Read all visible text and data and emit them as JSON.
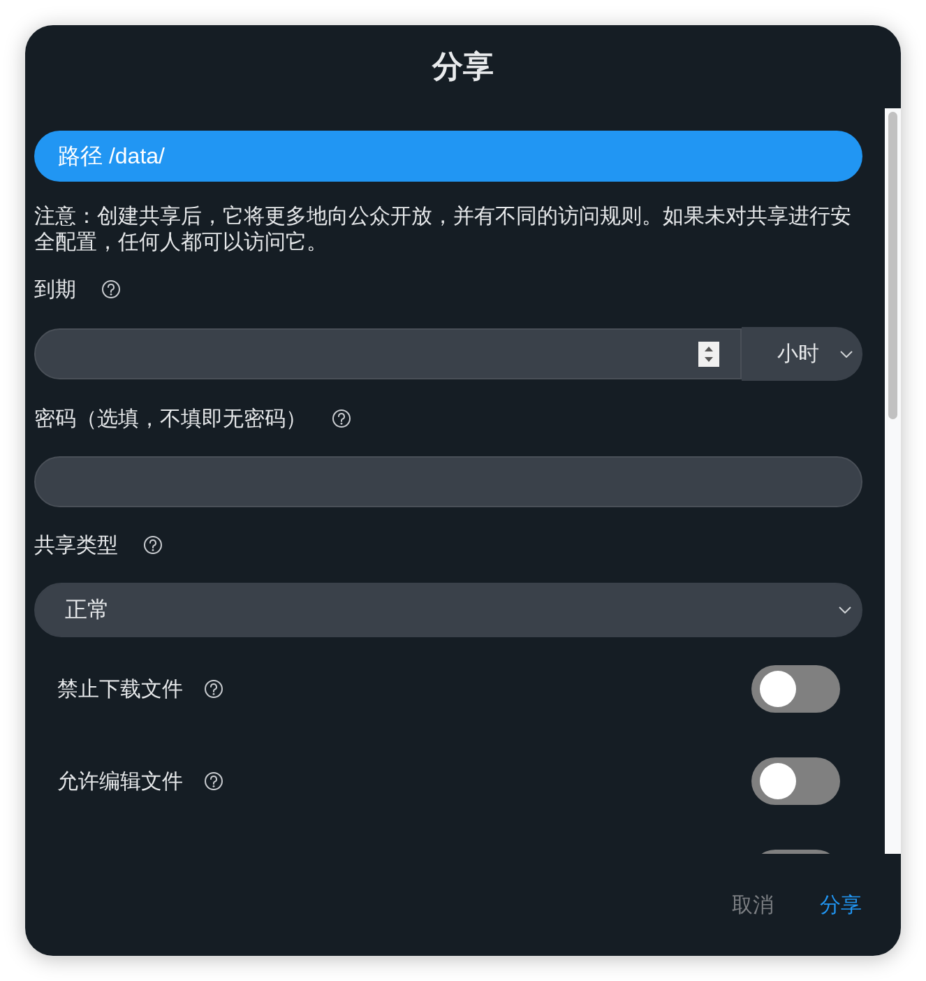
{
  "dialog": {
    "title": "分享"
  },
  "path": {
    "label": "路径",
    "value": "/data/"
  },
  "notice": "注意：创建共享后，它将更多地向公众开放，并有不同的访问规则。如果未对共享进行安全配置，任何人都可以访问它。",
  "expiry": {
    "label": "到期",
    "unit": "小时"
  },
  "password": {
    "label": "密码（选填，不填即无密码）"
  },
  "share_type": {
    "label": "共享类型",
    "value": "正常"
  },
  "toggles": [
    {
      "label": "禁止下载文件",
      "on": false
    },
    {
      "label": "允许编辑文件",
      "on": false
    },
    {
      "on": false
    }
  ],
  "buttons": [
    {
      "label": "取消",
      "kind": "secondary"
    },
    {
      "label": "分享",
      "kind": "primary"
    }
  ]
}
